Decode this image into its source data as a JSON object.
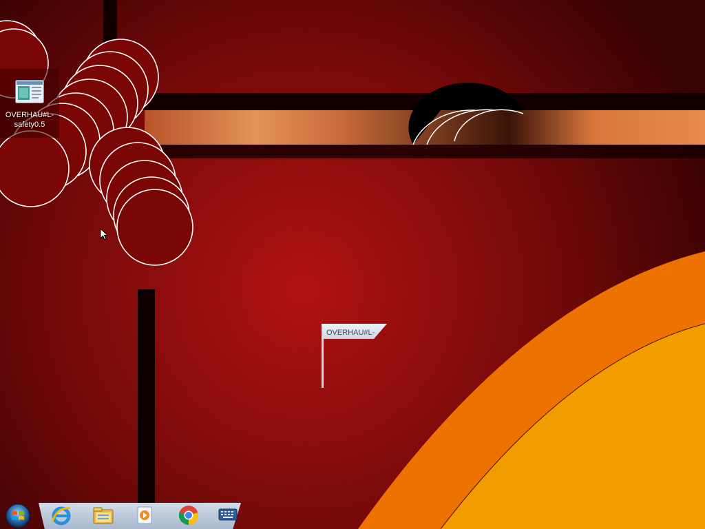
{
  "desktop": {
    "icons": [
      {
        "label": "OVERHAU#L-safety0.5",
        "icon": "program-window-icon"
      }
    ]
  },
  "window_fragment": {
    "title": "OVERHAU#L-"
  },
  "taskbar": {
    "start": {
      "icon": "windows-start-orb-icon"
    },
    "pinned": [
      {
        "icon": "internet-explorer-icon"
      },
      {
        "icon": "file-explorer-icon"
      },
      {
        "icon": "media-player-icon"
      },
      {
        "icon": "chrome-icon"
      },
      {
        "icon": "on-screen-keyboard-icon"
      }
    ]
  },
  "colors": {
    "wallpaper_dark_red": "#6e0808",
    "wallpaper_orange": "#ee7200",
    "wallpaper_amber": "#f39c00",
    "taskbar_glass": "#b8c6d8"
  }
}
